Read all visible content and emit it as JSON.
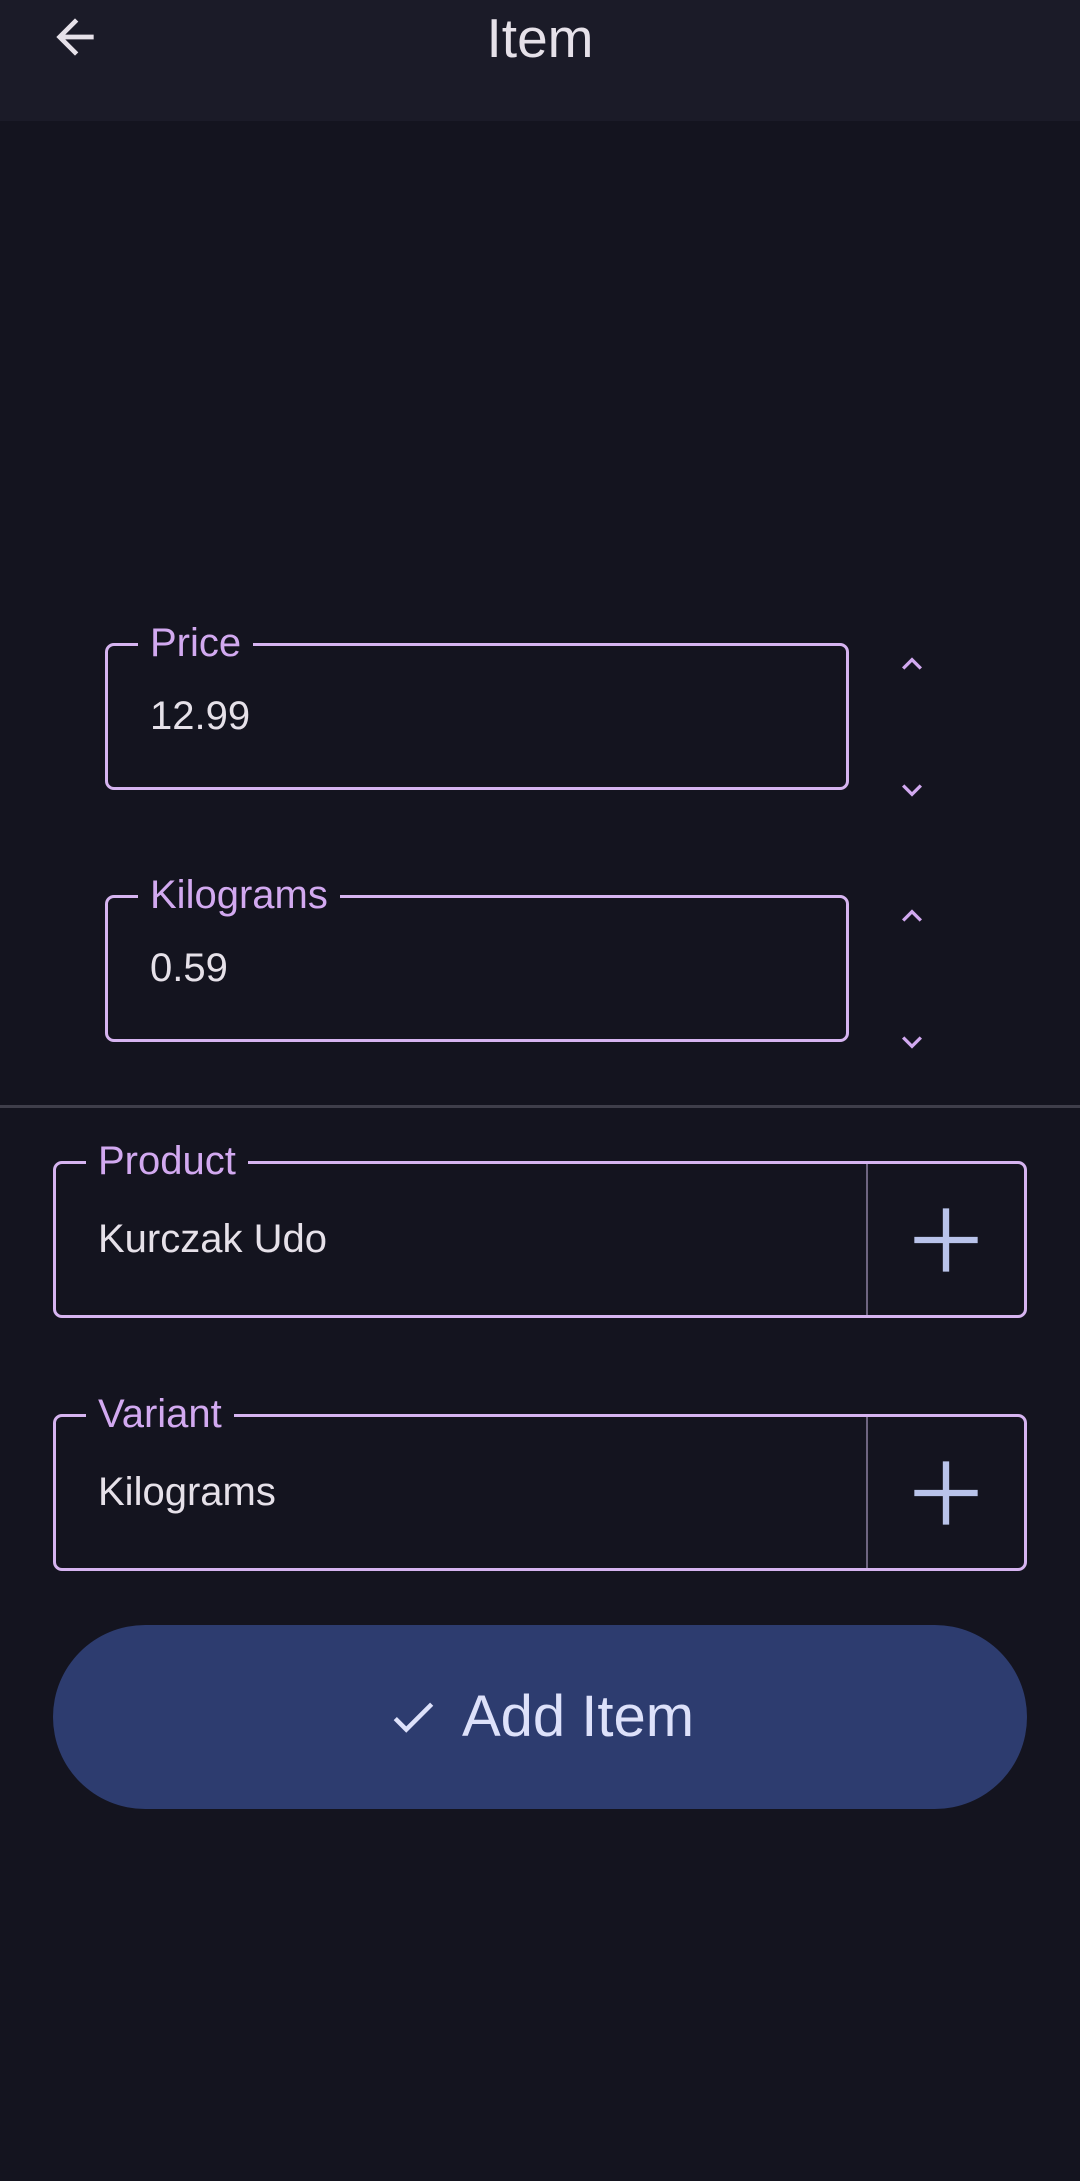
{
  "app_bar": {
    "title": "Item",
    "back_icon": "arrow-back-icon"
  },
  "price": {
    "label": "Price",
    "value": "12.99",
    "increment_icon": "chevron-up-icon",
    "decrement_icon": "chevron-down-icon"
  },
  "quantity": {
    "label": "Kilograms",
    "value": "0.59",
    "increment_icon": "chevron-up-icon",
    "decrement_icon": "chevron-down-icon"
  },
  "product": {
    "label": "Product",
    "value": "Kurczak Udo",
    "add_icon": "plus-icon"
  },
  "variant": {
    "label": "Variant",
    "value": "Kilograms",
    "add_icon": "plus-icon"
  },
  "submit": {
    "label": "Add Item",
    "icon": "check-icon"
  },
  "colors": {
    "background": "#14141f",
    "app_bar": "#1b1b28",
    "outline": "#d6b4f0",
    "label": "#d2a9f0",
    "button": "#2d3c6f",
    "plus": "#b9c3ea"
  }
}
